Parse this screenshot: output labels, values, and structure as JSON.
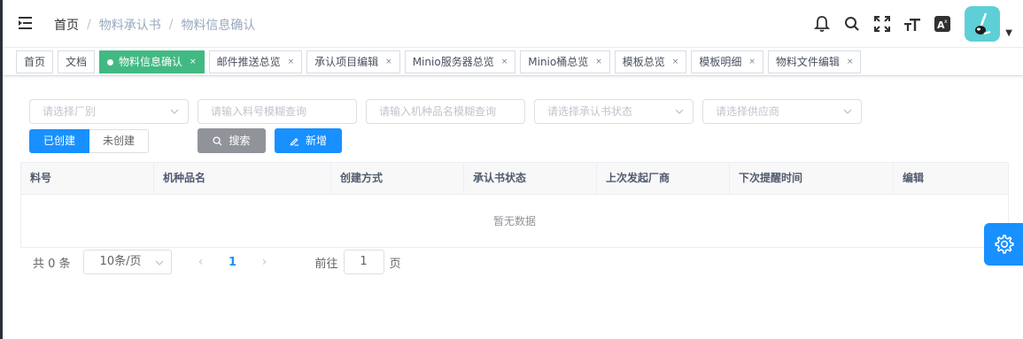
{
  "breadcrumb": [
    "首页",
    "物料承认书",
    "物料信息确认"
  ],
  "tags": [
    {
      "label": "首页",
      "active": false,
      "closable": false
    },
    {
      "label": "文档",
      "active": false,
      "closable": false
    },
    {
      "label": "物料信息确认",
      "active": true,
      "closable": true
    },
    {
      "label": "邮件推送总览",
      "active": false,
      "closable": true
    },
    {
      "label": "承认项目编辑",
      "active": false,
      "closable": true
    },
    {
      "label": "Minio服务器总览",
      "active": false,
      "closable": true
    },
    {
      "label": "Minio桶总览",
      "active": false,
      "closable": true
    },
    {
      "label": "模板总览",
      "active": false,
      "closable": true
    },
    {
      "label": "模板明细",
      "active": false,
      "closable": true
    },
    {
      "label": "物料文件编辑",
      "active": false,
      "closable": true
    }
  ],
  "tag_close_glyph": "×",
  "filters": {
    "factory": "请选择厂别",
    "part_no": "请输入料号模糊查询",
    "model_name": "请输入机种品名模糊查询",
    "status": "请选择承认书状态",
    "supplier": "请选择供应商"
  },
  "segment": {
    "created": "已创建",
    "not_created": "未创建"
  },
  "buttons": {
    "search": "搜索",
    "add": "新增"
  },
  "table": {
    "columns": [
      "料号",
      "机种品名",
      "创建方式",
      "承认书状态",
      "上次发起厂商",
      "下次提醒时间",
      "编辑"
    ],
    "empty_text": "暂无数据"
  },
  "pagination": {
    "total": "共 0 条",
    "page_size": "10条/页",
    "current_page": "1",
    "goto_label": "前往",
    "goto_value": "1",
    "page_suffix": "页",
    "prev": "‹",
    "next": "›"
  },
  "colors": {
    "primary": "#1890ff",
    "active_tag": "#42b983",
    "avatar_bg": "#5ecfd6"
  },
  "icons": [
    "hamburger-icon",
    "bell-icon",
    "search-icon",
    "fullscreen-icon",
    "font-size-icon",
    "translate-icon",
    "settings-gear-icon"
  ]
}
